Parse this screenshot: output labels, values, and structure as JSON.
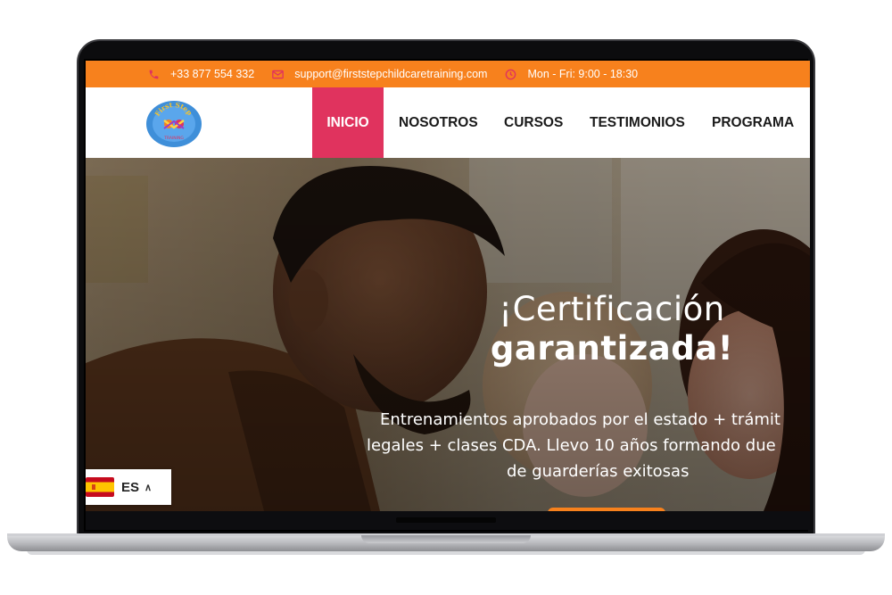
{
  "topbar": {
    "phone": "+33 877 554 332",
    "email": "support@firststepchildcaretraining.com",
    "hours": "Mon - Fri: 9:00 - 18:30",
    "icons": [
      "phone-icon",
      "envelope-icon",
      "clock-icon"
    ],
    "background": "#f7811d",
    "icon_color": "#e0335e"
  },
  "logo": {
    "text_top": "First Step",
    "text_bottom": "TRAINING"
  },
  "nav": {
    "items": [
      {
        "label": "INICIO",
        "active": true
      },
      {
        "label": "NOSOTROS",
        "active": false
      },
      {
        "label": "CURSOS",
        "active": false
      },
      {
        "label": "TESTIMONIOS",
        "active": false
      },
      {
        "label": "PROGRAMA",
        "active": false
      }
    ],
    "active_color": "#e0335e"
  },
  "hero": {
    "title_line1": "¡Certificación",
    "title_line2": "garantizada!",
    "subtitle_line1": "Entrenamientos aprobados por el estado + trámit",
    "subtitle_line2": "legales + clases CDA. Llevo 10 años formando due",
    "subtitle_line3": "de guarderías exitosas"
  },
  "language": {
    "code": "ES",
    "flag": "spain-flag-icon"
  }
}
